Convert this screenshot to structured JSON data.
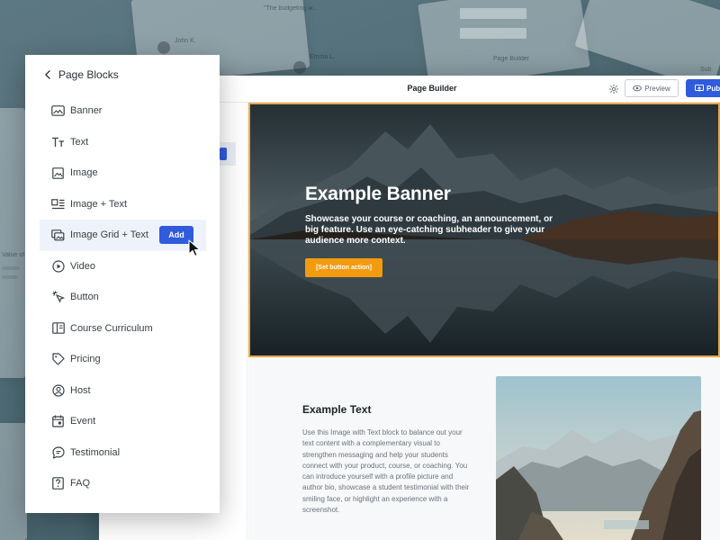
{
  "background": {
    "snippets": [
      "\"The budgeting w...",
      "John K.",
      "Emma L.",
      "Page Builder",
      "Sub",
      "Value of"
    ]
  },
  "builder": {
    "title": "Page Builder",
    "preview_label": "Preview",
    "publish_label": "Publi"
  },
  "banner": {
    "title": "Example Banner",
    "subtitle": "Showcase your course or coaching, an announcement, or big feature. Use an eye-catching subheader to give your audience more context.",
    "button_label": "[Set button action]"
  },
  "text_section": {
    "title": "Example Text",
    "body": "Use this Image with Text block to balance out your text content with a complementary visual to strengthen messaging and help your students connect with your product, course, or coaching. You can introduce yourself with a profile picture and author bio, showcase a student testimonial with their smiling face, or highlight an experience with a screenshot."
  },
  "panel": {
    "title": "Page Blocks",
    "add_label": "Add",
    "items": [
      {
        "label": "Banner",
        "icon": "banner-icon"
      },
      {
        "label": "Text",
        "icon": "text-icon"
      },
      {
        "label": "Image",
        "icon": "image-icon"
      },
      {
        "label": "Image + Text",
        "icon": "image-text-icon"
      },
      {
        "label": "Image Grid + Text",
        "icon": "image-grid-icon"
      },
      {
        "label": "Video",
        "icon": "video-icon"
      },
      {
        "label": "Button",
        "icon": "button-icon"
      },
      {
        "label": "Course Curriculum",
        "icon": "curriculum-icon"
      },
      {
        "label": "Pricing",
        "icon": "pricing-icon"
      },
      {
        "label": "Host",
        "icon": "host-icon"
      },
      {
        "label": "Event",
        "icon": "event-icon"
      },
      {
        "label": "Testimonial",
        "icon": "testimonial-icon"
      },
      {
        "label": "FAQ",
        "icon": "faq-icon"
      }
    ]
  },
  "colors": {
    "accent_blue": "#2f5bdc",
    "banner_button": "#f29b0f",
    "selection_border": "#e8a84a"
  }
}
